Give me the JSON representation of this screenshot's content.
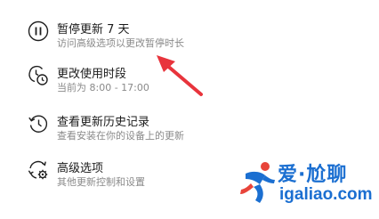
{
  "settings_items": [
    {
      "icon": "pause-icon",
      "title": "暂停更新 7 天",
      "subtitle": "访问高级选项以更改暂停时长"
    },
    {
      "icon": "clock-schedule-icon",
      "title": "更改使用时段",
      "subtitle": "当前为 8:00 - 17:00"
    },
    {
      "icon": "history-icon",
      "title": "查看更新历史记录",
      "subtitle": "查看安装在你的设备上的更新"
    },
    {
      "icon": "gear-sync-icon",
      "title": "高级选项",
      "subtitle": "其他更新控制和设置"
    }
  ],
  "annotation": {
    "icon": "red-arrow-icon",
    "color": "#e8343c"
  },
  "watermark": {
    "cn_text_1": "爱",
    "cn_sep": "·",
    "cn_text_2": "尬聊",
    "en_text": "igaliao.com",
    "brand_color": "#1b6fd1",
    "accent_color": "#e8443a"
  }
}
